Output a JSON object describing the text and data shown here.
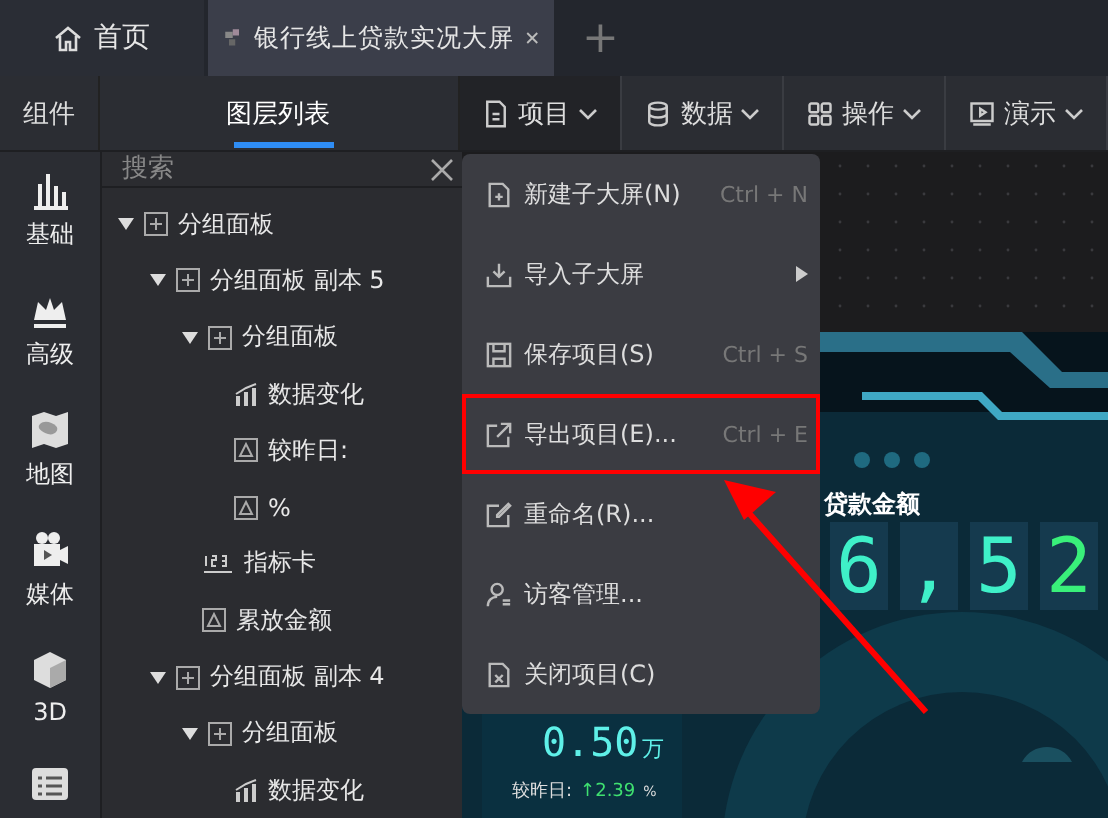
{
  "tabs": [
    {
      "label": "首页",
      "kind": "home",
      "selected": false
    },
    {
      "label": "银行线上贷款实况大屏",
      "kind": "document",
      "selected": true,
      "closable": true
    }
  ],
  "add_tab": "+",
  "panel_tabs": [
    {
      "label": "组件",
      "selected": false
    },
    {
      "label": "图层列表",
      "selected": true
    }
  ],
  "toolbar": [
    {
      "label": "项目",
      "kind": "file",
      "open": true
    },
    {
      "label": "数据",
      "kind": "database",
      "open": false
    },
    {
      "label": "操作",
      "kind": "grid",
      "open": false
    },
    {
      "label": "演示",
      "kind": "play",
      "open": false
    }
  ],
  "rail": [
    {
      "label": "基础",
      "kind": "bars"
    },
    {
      "label": "高级",
      "kind": "crown"
    },
    {
      "label": "地图",
      "kind": "map"
    },
    {
      "label": "媒体",
      "kind": "camera"
    },
    {
      "label": "3D",
      "kind": "cube"
    },
    {
      "kind": "list"
    }
  ],
  "search": {
    "placeholder": "搜索"
  },
  "layers": [
    {
      "label": "分组面板",
      "kind": "group",
      "expanded": true,
      "children": [
        {
          "label": "分组面板 副本 5",
          "kind": "group",
          "expanded": true,
          "children": [
            {
              "label": "分组面板",
              "kind": "group",
              "expanded": true,
              "children": [
                {
                  "label": "数据变化",
                  "kind": "chart"
                },
                {
                  "label": "较昨日:",
                  "kind": "text"
                },
                {
                  "label": "%",
                  "kind": "text"
                }
              ]
            },
            {
              "label": "指标卡",
              "kind": "number"
            },
            {
              "label": "累放金额",
              "kind": "text"
            }
          ]
        },
        {
          "label": "分组面板 副本 4",
          "kind": "group",
          "expanded": true,
          "children": [
            {
              "label": "分组面板",
              "kind": "group",
              "expanded": true,
              "children": [
                {
                  "label": "数据变化",
                  "kind": "chart"
                }
              ]
            }
          ]
        }
      ]
    }
  ],
  "menu": [
    {
      "label": "新建子大屏(N)",
      "kind": "new",
      "shortcut": "Ctrl + N",
      "highlighted": false
    },
    {
      "label": "导入子大屏",
      "kind": "import",
      "submenu": true,
      "highlighted": false
    },
    {
      "label": "保存项目(S)",
      "kind": "save",
      "shortcut": "Ctrl + S",
      "highlighted": false
    },
    {
      "label": "导出项目(E)...",
      "kind": "export",
      "shortcut": "Ctrl + E",
      "highlighted": true
    },
    {
      "label": "重命名(R)...",
      "kind": "rename",
      "highlighted": false
    },
    {
      "label": "访客管理...",
      "kind": "visitor",
      "highlighted": false
    },
    {
      "label": "关闭项目(C)",
      "kind": "close",
      "highlighted": false
    }
  ],
  "dashboard": {
    "title": "贷款金额",
    "digits": [
      "6",
      ",",
      "5",
      "2"
    ],
    "card": {
      "value": "0.50",
      "unit": "万",
      "compare_label": "较昨日:",
      "change": "↑2.39",
      "change_unit": "%"
    }
  }
}
